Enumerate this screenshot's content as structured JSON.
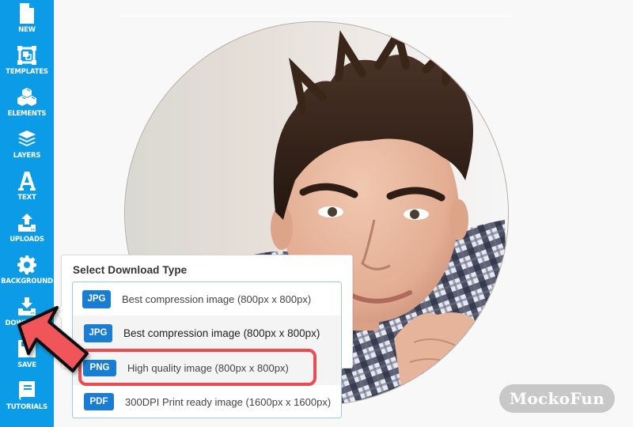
{
  "sidebar": {
    "items": [
      {
        "id": "new",
        "label": "NEW",
        "icon": "file-icon"
      },
      {
        "id": "templates",
        "label": "TEMPLATES",
        "icon": "templates-icon"
      },
      {
        "id": "elements",
        "label": "ELEMENTS",
        "icon": "cubes-icon"
      },
      {
        "id": "layers",
        "label": "LAYERS",
        "icon": "layers-icon"
      },
      {
        "id": "text",
        "label": "TEXT",
        "icon": "text-icon"
      },
      {
        "id": "uploads",
        "label": "UPLOADS",
        "icon": "upload-icon"
      },
      {
        "id": "background",
        "label": "BACKGROUND",
        "icon": "gear-icon"
      },
      {
        "id": "download",
        "label": "DOWNLOAD",
        "icon": "download-icon"
      },
      {
        "id": "save",
        "label": "SAVE",
        "icon": "save-icon"
      },
      {
        "id": "tutorials",
        "label": "TUTORIALS",
        "icon": "book-icon"
      }
    ],
    "color": "#0c9be6"
  },
  "download_popup": {
    "title": "Select Download Type",
    "options": [
      {
        "format": "JPG",
        "description": "Best compression image (800px x 800px)"
      },
      {
        "format": "JPG",
        "description": "Best compression image (800px x 800px)"
      },
      {
        "format": "PNG",
        "description": "High quality image (800px x 800px)",
        "highlighted": true
      },
      {
        "format": "PDF",
        "description": "300DPI Print ready image (1600px x 1600px)"
      }
    ],
    "badge_color": "#1a7dd4",
    "highlight_color": "#ef4a4f"
  },
  "canvas": {
    "image": "circular portrait photo of a man with styled dark hair in a plaid shirt"
  },
  "watermark": "MockoFun"
}
